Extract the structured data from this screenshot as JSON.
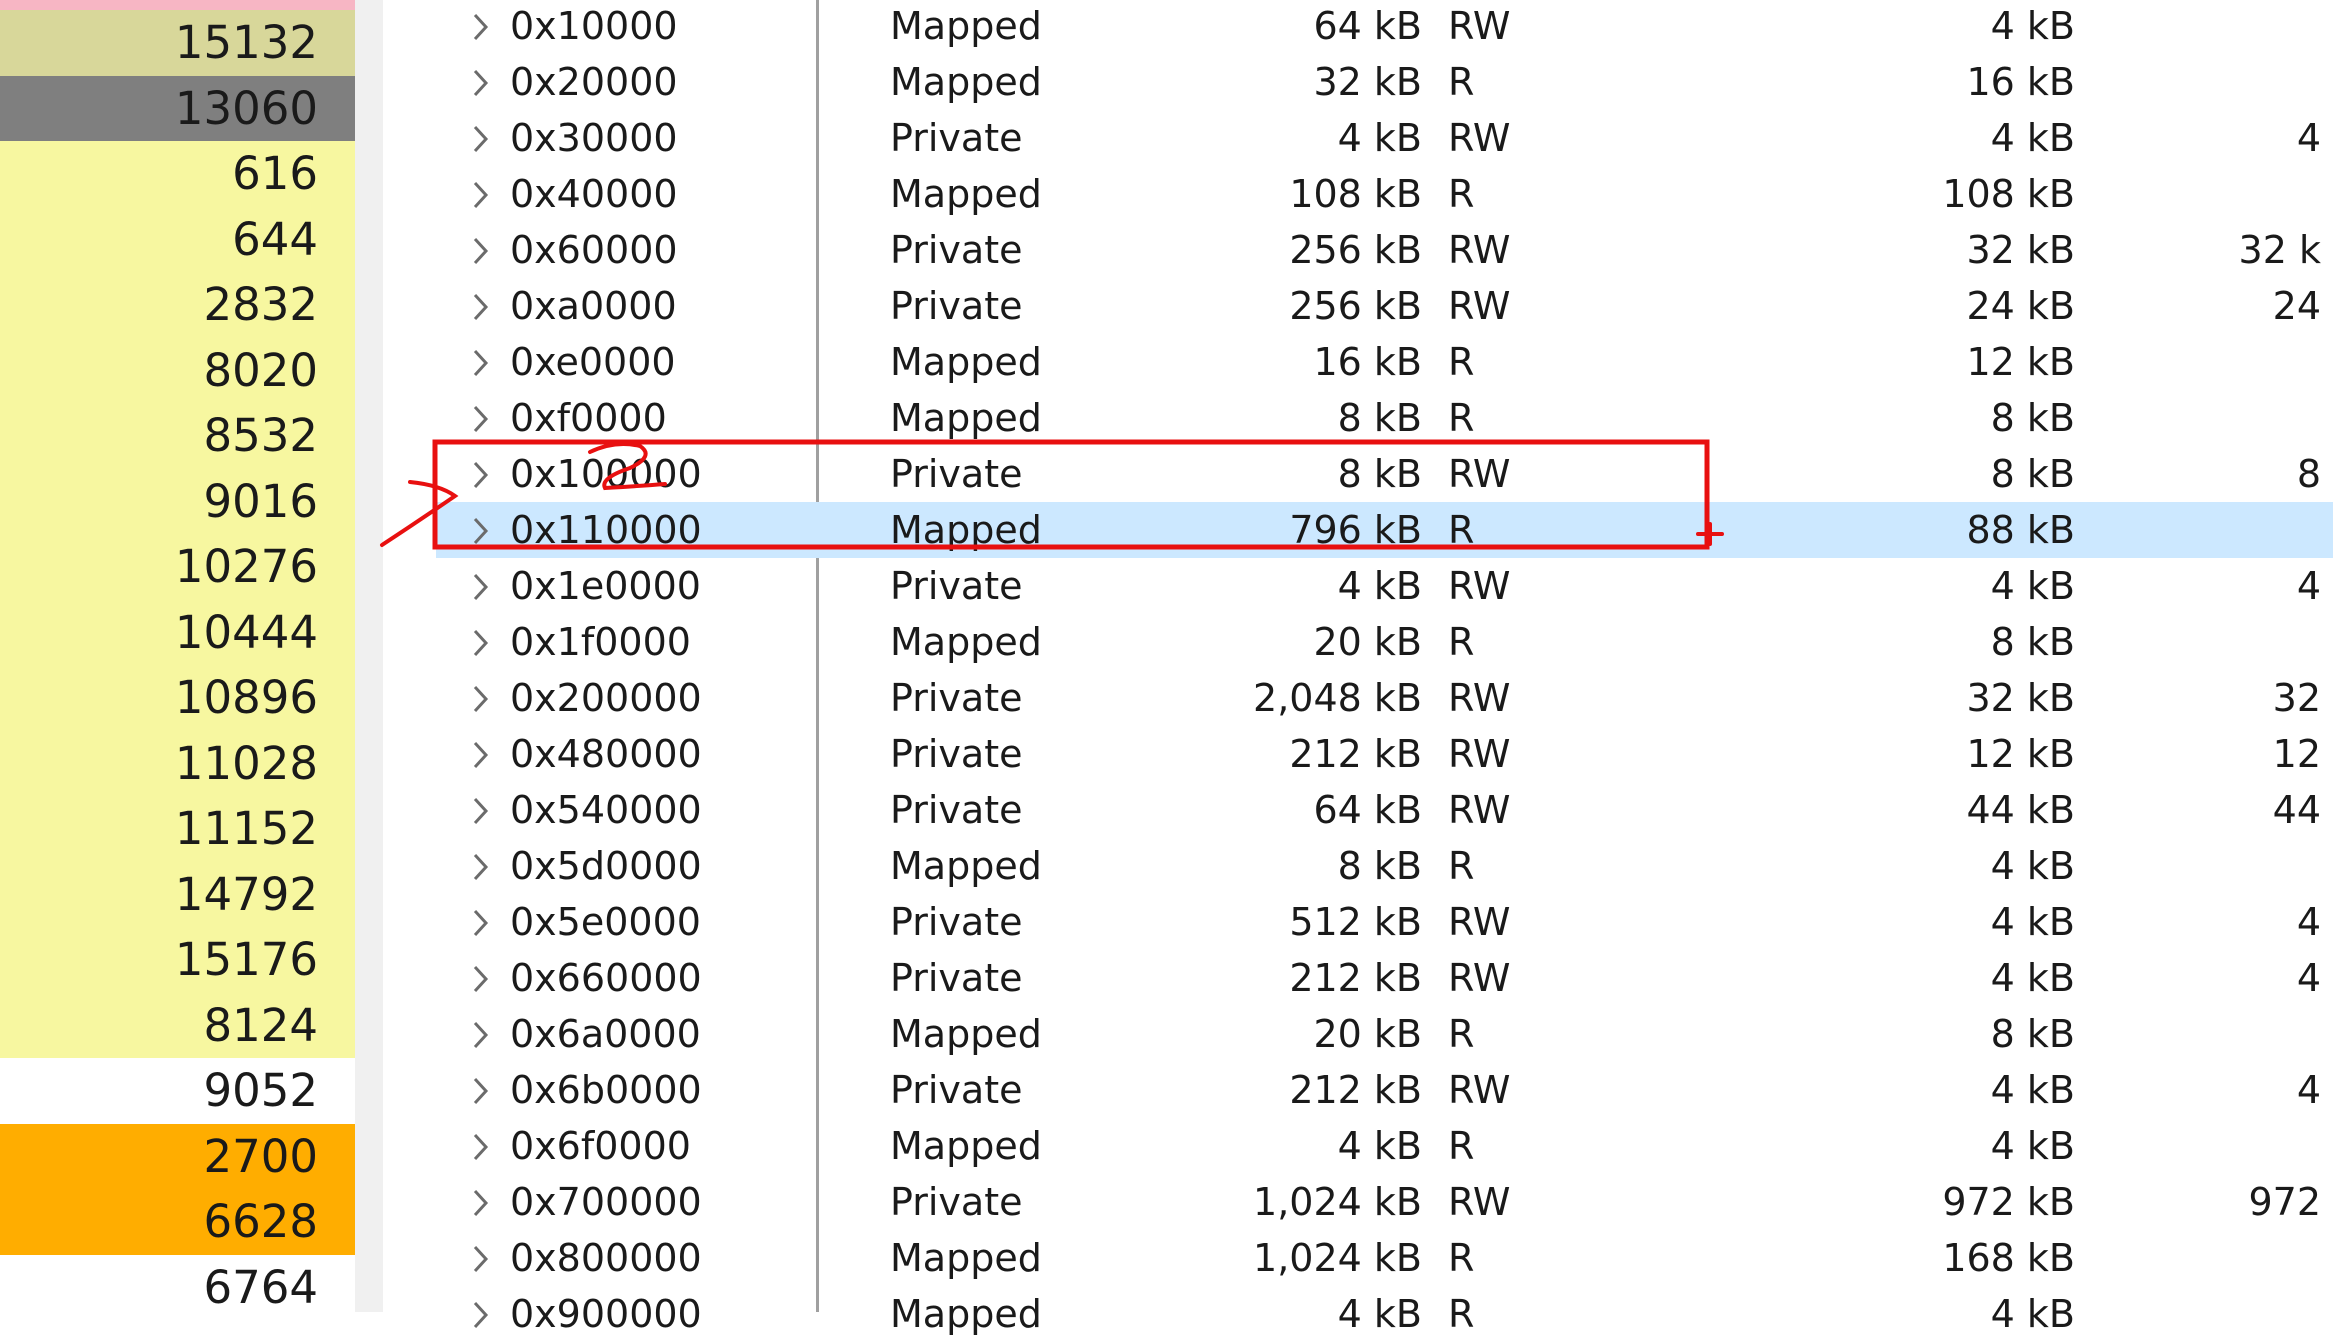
{
  "colors": {
    "pink": "#f7b6c4",
    "khaki": "#d8d79a",
    "gray": "#7f7f7f",
    "yellow": "#f7f7a0",
    "white": "#ffffff",
    "orange": "#ffad00",
    "selected_row": "#cce8ff",
    "annotation": "#e81010"
  },
  "process_list": [
    {
      "pid": "15132",
      "color": "khaki"
    },
    {
      "pid": "13060",
      "color": "gray"
    },
    {
      "pid": "616",
      "color": "yellow"
    },
    {
      "pid": "644",
      "color": "yellow"
    },
    {
      "pid": "2832",
      "color": "yellow"
    },
    {
      "pid": "8020",
      "color": "yellow"
    },
    {
      "pid": "8532",
      "color": "yellow"
    },
    {
      "pid": "9016",
      "color": "yellow"
    },
    {
      "pid": "10276",
      "color": "yellow"
    },
    {
      "pid": "10444",
      "color": "yellow"
    },
    {
      "pid": "10896",
      "color": "yellow"
    },
    {
      "pid": "11028",
      "color": "yellow"
    },
    {
      "pid": "11152",
      "color": "yellow"
    },
    {
      "pid": "14792",
      "color": "yellow"
    },
    {
      "pid": "15176",
      "color": "yellow"
    },
    {
      "pid": "8124",
      "color": "yellow"
    },
    {
      "pid": "9052",
      "color": "white"
    },
    {
      "pid": "2700",
      "color": "orange"
    },
    {
      "pid": "6628",
      "color": "orange"
    },
    {
      "pid": "6764",
      "color": "white"
    }
  ],
  "memory_regions": [
    {
      "address": "0x10000",
      "type": "Mapped",
      "size": "64 kB",
      "protection": "RW",
      "committed": "4 kB",
      "private": ""
    },
    {
      "address": "0x20000",
      "type": "Mapped",
      "size": "32 kB",
      "protection": "R",
      "committed": "16 kB",
      "private": ""
    },
    {
      "address": "0x30000",
      "type": "Private",
      "size": "4 kB",
      "protection": "RW",
      "committed": "4 kB",
      "private": "4"
    },
    {
      "address": "0x40000",
      "type": "Mapped",
      "size": "108 kB",
      "protection": "R",
      "committed": "108 kB",
      "private": ""
    },
    {
      "address": "0x60000",
      "type": "Private",
      "size": "256 kB",
      "protection": "RW",
      "committed": "32 kB",
      "private": "32 k"
    },
    {
      "address": "0xa0000",
      "type": "Private",
      "size": "256 kB",
      "protection": "RW",
      "committed": "24 kB",
      "private": "24"
    },
    {
      "address": "0xe0000",
      "type": "Mapped",
      "size": "16 kB",
      "protection": "R",
      "committed": "12 kB",
      "private": ""
    },
    {
      "address": "0xf0000",
      "type": "Mapped",
      "size": "8 kB",
      "protection": "R",
      "committed": "8 kB",
      "private": ""
    },
    {
      "address": "0x100000",
      "type": "Private",
      "size": "8 kB",
      "protection": "RW",
      "committed": "8 kB",
      "private": "8"
    },
    {
      "address": "0x110000",
      "type": "Mapped",
      "size": "796 kB",
      "protection": "R",
      "committed": "88 kB",
      "private": "",
      "selected": true
    },
    {
      "address": "0x1e0000",
      "type": "Private",
      "size": "4 kB",
      "protection": "RW",
      "committed": "4 kB",
      "private": "4"
    },
    {
      "address": "0x1f0000",
      "type": "Mapped",
      "size": "20 kB",
      "protection": "R",
      "committed": "8 kB",
      "private": ""
    },
    {
      "address": "0x200000",
      "type": "Private",
      "size": "2,048 kB",
      "protection": "RW",
      "committed": "32 kB",
      "private": "32"
    },
    {
      "address": "0x480000",
      "type": "Private",
      "size": "212 kB",
      "protection": "RW",
      "committed": "12 kB",
      "private": "12"
    },
    {
      "address": "0x540000",
      "type": "Private",
      "size": "64 kB",
      "protection": "RW",
      "committed": "44 kB",
      "private": "44"
    },
    {
      "address": "0x5d0000",
      "type": "Mapped",
      "size": "8 kB",
      "protection": "R",
      "committed": "4 kB",
      "private": ""
    },
    {
      "address": "0x5e0000",
      "type": "Private",
      "size": "512 kB",
      "protection": "RW",
      "committed": "4 kB",
      "private": "4"
    },
    {
      "address": "0x660000",
      "type": "Private",
      "size": "212 kB",
      "protection": "RW",
      "committed": "4 kB",
      "private": "4"
    },
    {
      "address": "0x6a0000",
      "type": "Mapped",
      "size": "20 kB",
      "protection": "R",
      "committed": "8 kB",
      "private": ""
    },
    {
      "address": "0x6b0000",
      "type": "Private",
      "size": "212 kB",
      "protection": "RW",
      "committed": "4 kB",
      "private": "4"
    },
    {
      "address": "0x6f0000",
      "type": "Mapped",
      "size": "4 kB",
      "protection": "R",
      "committed": "4 kB",
      "private": ""
    },
    {
      "address": "0x700000",
      "type": "Private",
      "size": "1,024 kB",
      "protection": "RW",
      "committed": "972 kB",
      "private": "972"
    },
    {
      "address": "0x800000",
      "type": "Mapped",
      "size": "1,024 kB",
      "protection": "R",
      "committed": "168 kB",
      "private": ""
    },
    {
      "address": "0x900000",
      "type": "Mapped",
      "size": "4 kB",
      "protection": "R",
      "committed": "4 kB",
      "private": ""
    }
  ],
  "icons": {
    "expand": "chevron-right-icon"
  }
}
